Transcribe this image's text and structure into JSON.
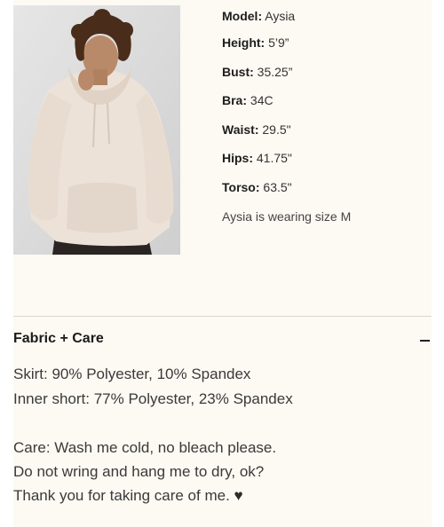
{
  "model_specs": [
    {
      "label": "Model:",
      "value": "Aysia"
    },
    {
      "label": "Height:",
      "value": "5’9”"
    },
    {
      "label": "Bust:",
      "value": "35.25”"
    },
    {
      "label": "Bra:",
      "value": "34C"
    },
    {
      "label": "Waist:",
      "value": "29.5\""
    },
    {
      "label": "Hips:",
      "value": "41.75\""
    },
    {
      "label": "Torso:",
      "value": "63.5\""
    }
  ],
  "wearing_note": "Aysia is wearing size M",
  "fabric_section": {
    "title": "Fabric + Care",
    "toggle_icon": "minus-icon",
    "composition": [
      "Skirt: 90% Polyester, 10% Spandex",
      "Inner short: 77% Polyester, 23% Spandex"
    ],
    "care": [
      "Care: Wash me cold, no bleach please.",
      "Do not wring and hang me to dry, ok?",
      "Thank you for taking care of me."
    ],
    "care_icon": "heart-icon",
    "heart_glyph": "♥"
  },
  "colors": {
    "panel_background": "#fdf9f3",
    "divider": "#dcd6cf",
    "text": "#2b2b2b"
  }
}
